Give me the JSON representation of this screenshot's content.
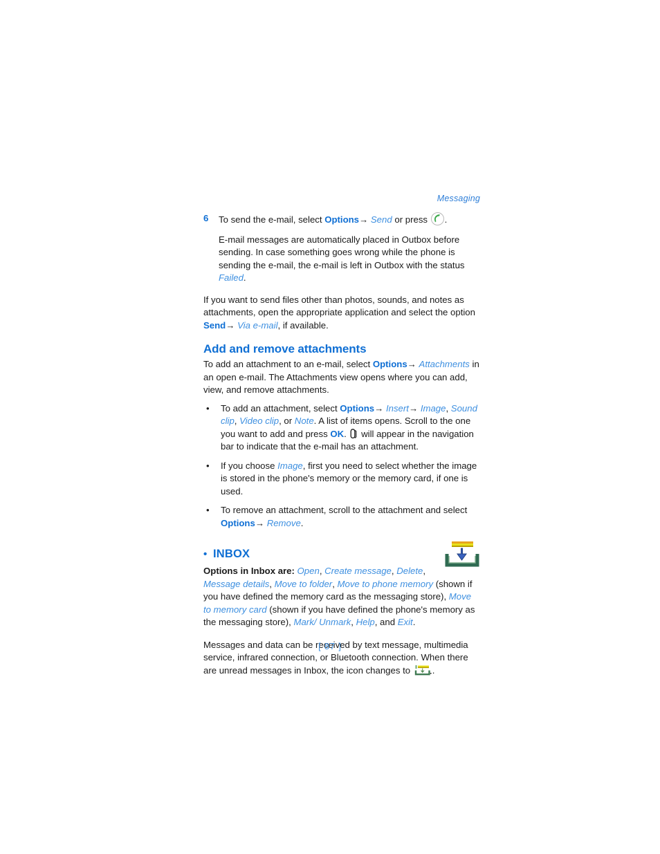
{
  "page": {
    "running_header": "Messaging",
    "folio": "[ 87 ]"
  },
  "step6": {
    "number": "6",
    "lead": "To send the e-mail, select ",
    "options_label": "Options",
    "arrow": "→",
    "send_label": "Send",
    "mid": " or press ",
    "call_icon": "call-icon",
    "end": ".",
    "sub_1": "E-mail messages are automatically placed in Outbox before sending. In case something goes wrong while the phone is sending the e-mail, the e-mail is left in Outbox with the status ",
    "sub_status": "Failed",
    "sub_2": "."
  },
  "attach_note": {
    "text_1": "If you want to send files other than photos, sounds, and notes as attachments, open the appropriate application and select the option ",
    "send_label": "Send",
    "arrow": "→",
    "via_email_label": "Via e-mail",
    "text_2": ", if available."
  },
  "section": {
    "heading": "Add and remove attachments",
    "intro_1": "To add an attachment to an e-mail, select ",
    "options_label": "Options",
    "arrow": "→",
    "attachments_label": "Attachments",
    "intro_2": " in an open e-mail. The Attachments view opens where you can add, view, and remove attachments.",
    "bullets": [
      {
        "marker": "•",
        "t1": "To add an attachment, select ",
        "options_label": "Options",
        "arrow1": "→",
        "insert_label": "Insert",
        "arrow2": "→",
        "image_label": "Image",
        "sep1": ", ",
        "sound_label": "Sound clip",
        "sep2": ", ",
        "video_label": "Video clip",
        "sep3": ", or ",
        "note_label": "Note",
        "t2": ". A list of items opens. Scroll to the one you want to add and press ",
        "ok_label": "OK",
        "t3": ". ",
        "clip_icon": "attachment-clip-icon",
        "t4": " will appear in the navigation bar to indicate that the e-mail has an attachment."
      },
      {
        "marker": "•",
        "t1": "If you choose ",
        "image_label": "Image",
        "t2": ", first you need to select whether the image is stored in the phone's memory or the memory card, if one is used."
      },
      {
        "marker": "•",
        "t1": "To remove an attachment, scroll to the attachment and select ",
        "options_label": "Options",
        "arrow1": "→",
        "remove_label": "Remove",
        "t2": "."
      }
    ]
  },
  "inbox": {
    "marker": "•",
    "heading": "INBOX",
    "icon_large": "inbox-icon",
    "icon_small": "inbox-unread-icon",
    "options_lead": "Options in Inbox are: ",
    "items": {
      "open": "Open",
      "create_message": "Create message",
      "delete": "Delete",
      "message_details": "Message details",
      "move_to_folder": "Move to folder",
      "move_to_phone_memory": "Move to phone memory",
      "move_to_memory_card": "Move to memory card",
      "mark_unmark": "Mark/ Unmark",
      "help": "Help",
      "exit": "Exit"
    },
    "sep_comma": ", ",
    "note_phone_mem": " (shown if you have defined the memory card as the messaging store), ",
    "note_mem_card": " (shown if you have defined the phone's memory as the messaging store), ",
    "tail_sep_1": ", ",
    "tail_and": ", and ",
    "tail_period": ".",
    "para2_1": "Messages and data can be received by text message, multimedia service, infrared connection, or Bluetooth connection. When there are unread messages in Inbox, the icon changes to ",
    "para2_2": "."
  },
  "colors": {
    "heading_blue": "#0f6fd4",
    "italic_blue": "#3d8fe0",
    "body_text": "#1a1a1a",
    "icon_green": "#3aa84a",
    "icon_yellow": "#e8c21c",
    "icon_tray_green": "#2f6b52",
    "icon_arrow_blue": "#3a63c0"
  }
}
